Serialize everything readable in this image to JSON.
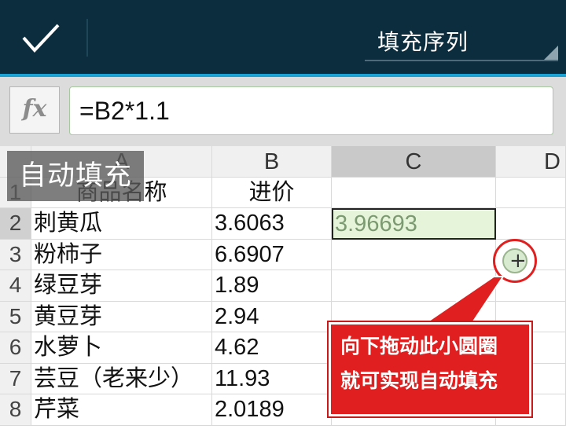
{
  "toolbar": {
    "mode_label": "填充序列",
    "confirm_icon": "check-icon"
  },
  "formula": {
    "fx_label": "fx",
    "value": "=B2*1.1"
  },
  "columns": [
    "A",
    "B",
    "C",
    "D"
  ],
  "rows": [
    {
      "num": "1",
      "a": "商品名称",
      "b": "进价",
      "c": ""
    },
    {
      "num": "2",
      "a": "刺黄瓜",
      "b": "3.6063",
      "c": "3.96693"
    },
    {
      "num": "3",
      "a": "粉柿子",
      "b": "6.6907",
      "c": ""
    },
    {
      "num": "4",
      "a": "绿豆芽",
      "b": "1.89",
      "c": ""
    },
    {
      "num": "5",
      "a": "黄豆芽",
      "b": "2.94",
      "c": ""
    },
    {
      "num": "6",
      "a": "水萝卜",
      "b": "4.62",
      "c": ""
    },
    {
      "num": "7",
      "a": "芸豆（老来少）",
      "b": "11.93",
      "c": ""
    },
    {
      "num": "8",
      "a": "芹菜",
      "b": "2.0189",
      "c": ""
    }
  ],
  "overlay": {
    "autofill_label": "自动填充",
    "callout_line1": "向下拖动此小圆圈",
    "callout_line2": "就可实现自动填充"
  },
  "colors": {
    "topbar": "#0b2d3d",
    "accent": "#1ba3d6",
    "callout": "#e02020",
    "selected_fill": "#e6f4d9"
  }
}
